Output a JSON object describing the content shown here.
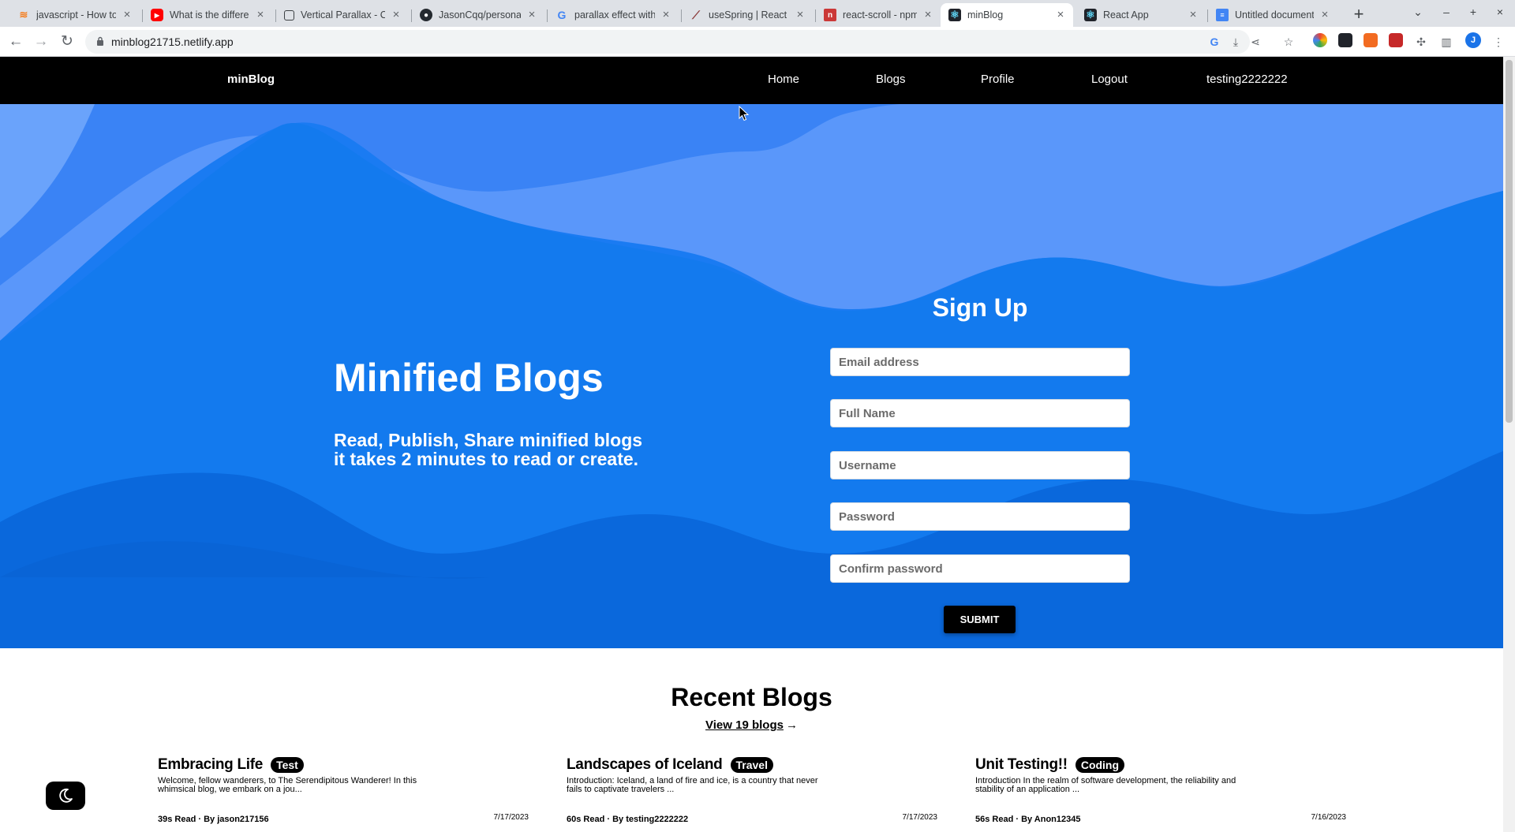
{
  "browser": {
    "tabs": [
      {
        "title": "javascript - How to",
        "favicon": "so-icon",
        "color": "#f48024"
      },
      {
        "title": "What is the differe",
        "favicon": "youtube-icon",
        "color": "#ff0000"
      },
      {
        "title": "Vertical Parallax - C",
        "favicon": "page-icon",
        "color": "#ffffff"
      },
      {
        "title": "JasonCqq/personal",
        "favicon": "github-icon",
        "color": "#24292f"
      },
      {
        "title": "parallax effect with",
        "favicon": "google-icon",
        "color": "#4285f4"
      },
      {
        "title": "useSpring | React",
        "favicon": "spring-icon",
        "color": "#8b3a3a"
      },
      {
        "title": "react-scroll - npm",
        "favicon": "npm-icon",
        "color": "#cb3837"
      },
      {
        "title": "minBlog",
        "favicon": "react-icon",
        "color": "#61dafb"
      },
      {
        "title": "React App",
        "favicon": "react-icon",
        "color": "#61dafb"
      },
      {
        "title": "Untitled document",
        "favicon": "docs-icon",
        "color": "#4285f4"
      }
    ],
    "url": "minblog21715.netlify.app"
  },
  "nav": {
    "brand": "minBlog",
    "links": [
      "Home",
      "Blogs",
      "Profile",
      "Logout",
      "testing2222222"
    ]
  },
  "hero": {
    "title": "Minified Blogs",
    "subtitle_line1": "Read, Publish, Share minified blogs",
    "subtitle_line2": "it takes 2 minutes to read or create."
  },
  "signup": {
    "title": "Sign Up",
    "fields": {
      "email": "Email address",
      "fullname": "Full Name",
      "username": "Username",
      "password": "Password",
      "confirm": "Confirm password"
    },
    "submit": "SUBMIT"
  },
  "recent": {
    "title": "Recent Blogs",
    "view_link": "View 19 blogs",
    "cards": [
      {
        "title": "Embracing Life",
        "tag": "Test",
        "excerpt": "Welcome, fellow wanderers, to The Serendipitous Wanderer! In this whimsical blog, we embark on a jou...",
        "meta": "39s Read · By jason217156",
        "date": "7/17/2023"
      },
      {
        "title": "Landscapes of Iceland",
        "tag": "Travel",
        "excerpt": "Introduction: Iceland, a land of fire and ice, is a country that never fails to captivate travelers ...",
        "meta": "60s Read · By testing2222222",
        "date": "7/17/2023"
      },
      {
        "title": "Unit Testing!!",
        "tag": "Coding",
        "excerpt": "Introduction In the realm of software development, the reliability and stability of an application ...",
        "meta": "56s Read · By Anon12345",
        "date": "7/16/2023"
      }
    ]
  },
  "colors": {
    "hero_blue": "#0b6fe8",
    "nav_bg": "#000000"
  }
}
